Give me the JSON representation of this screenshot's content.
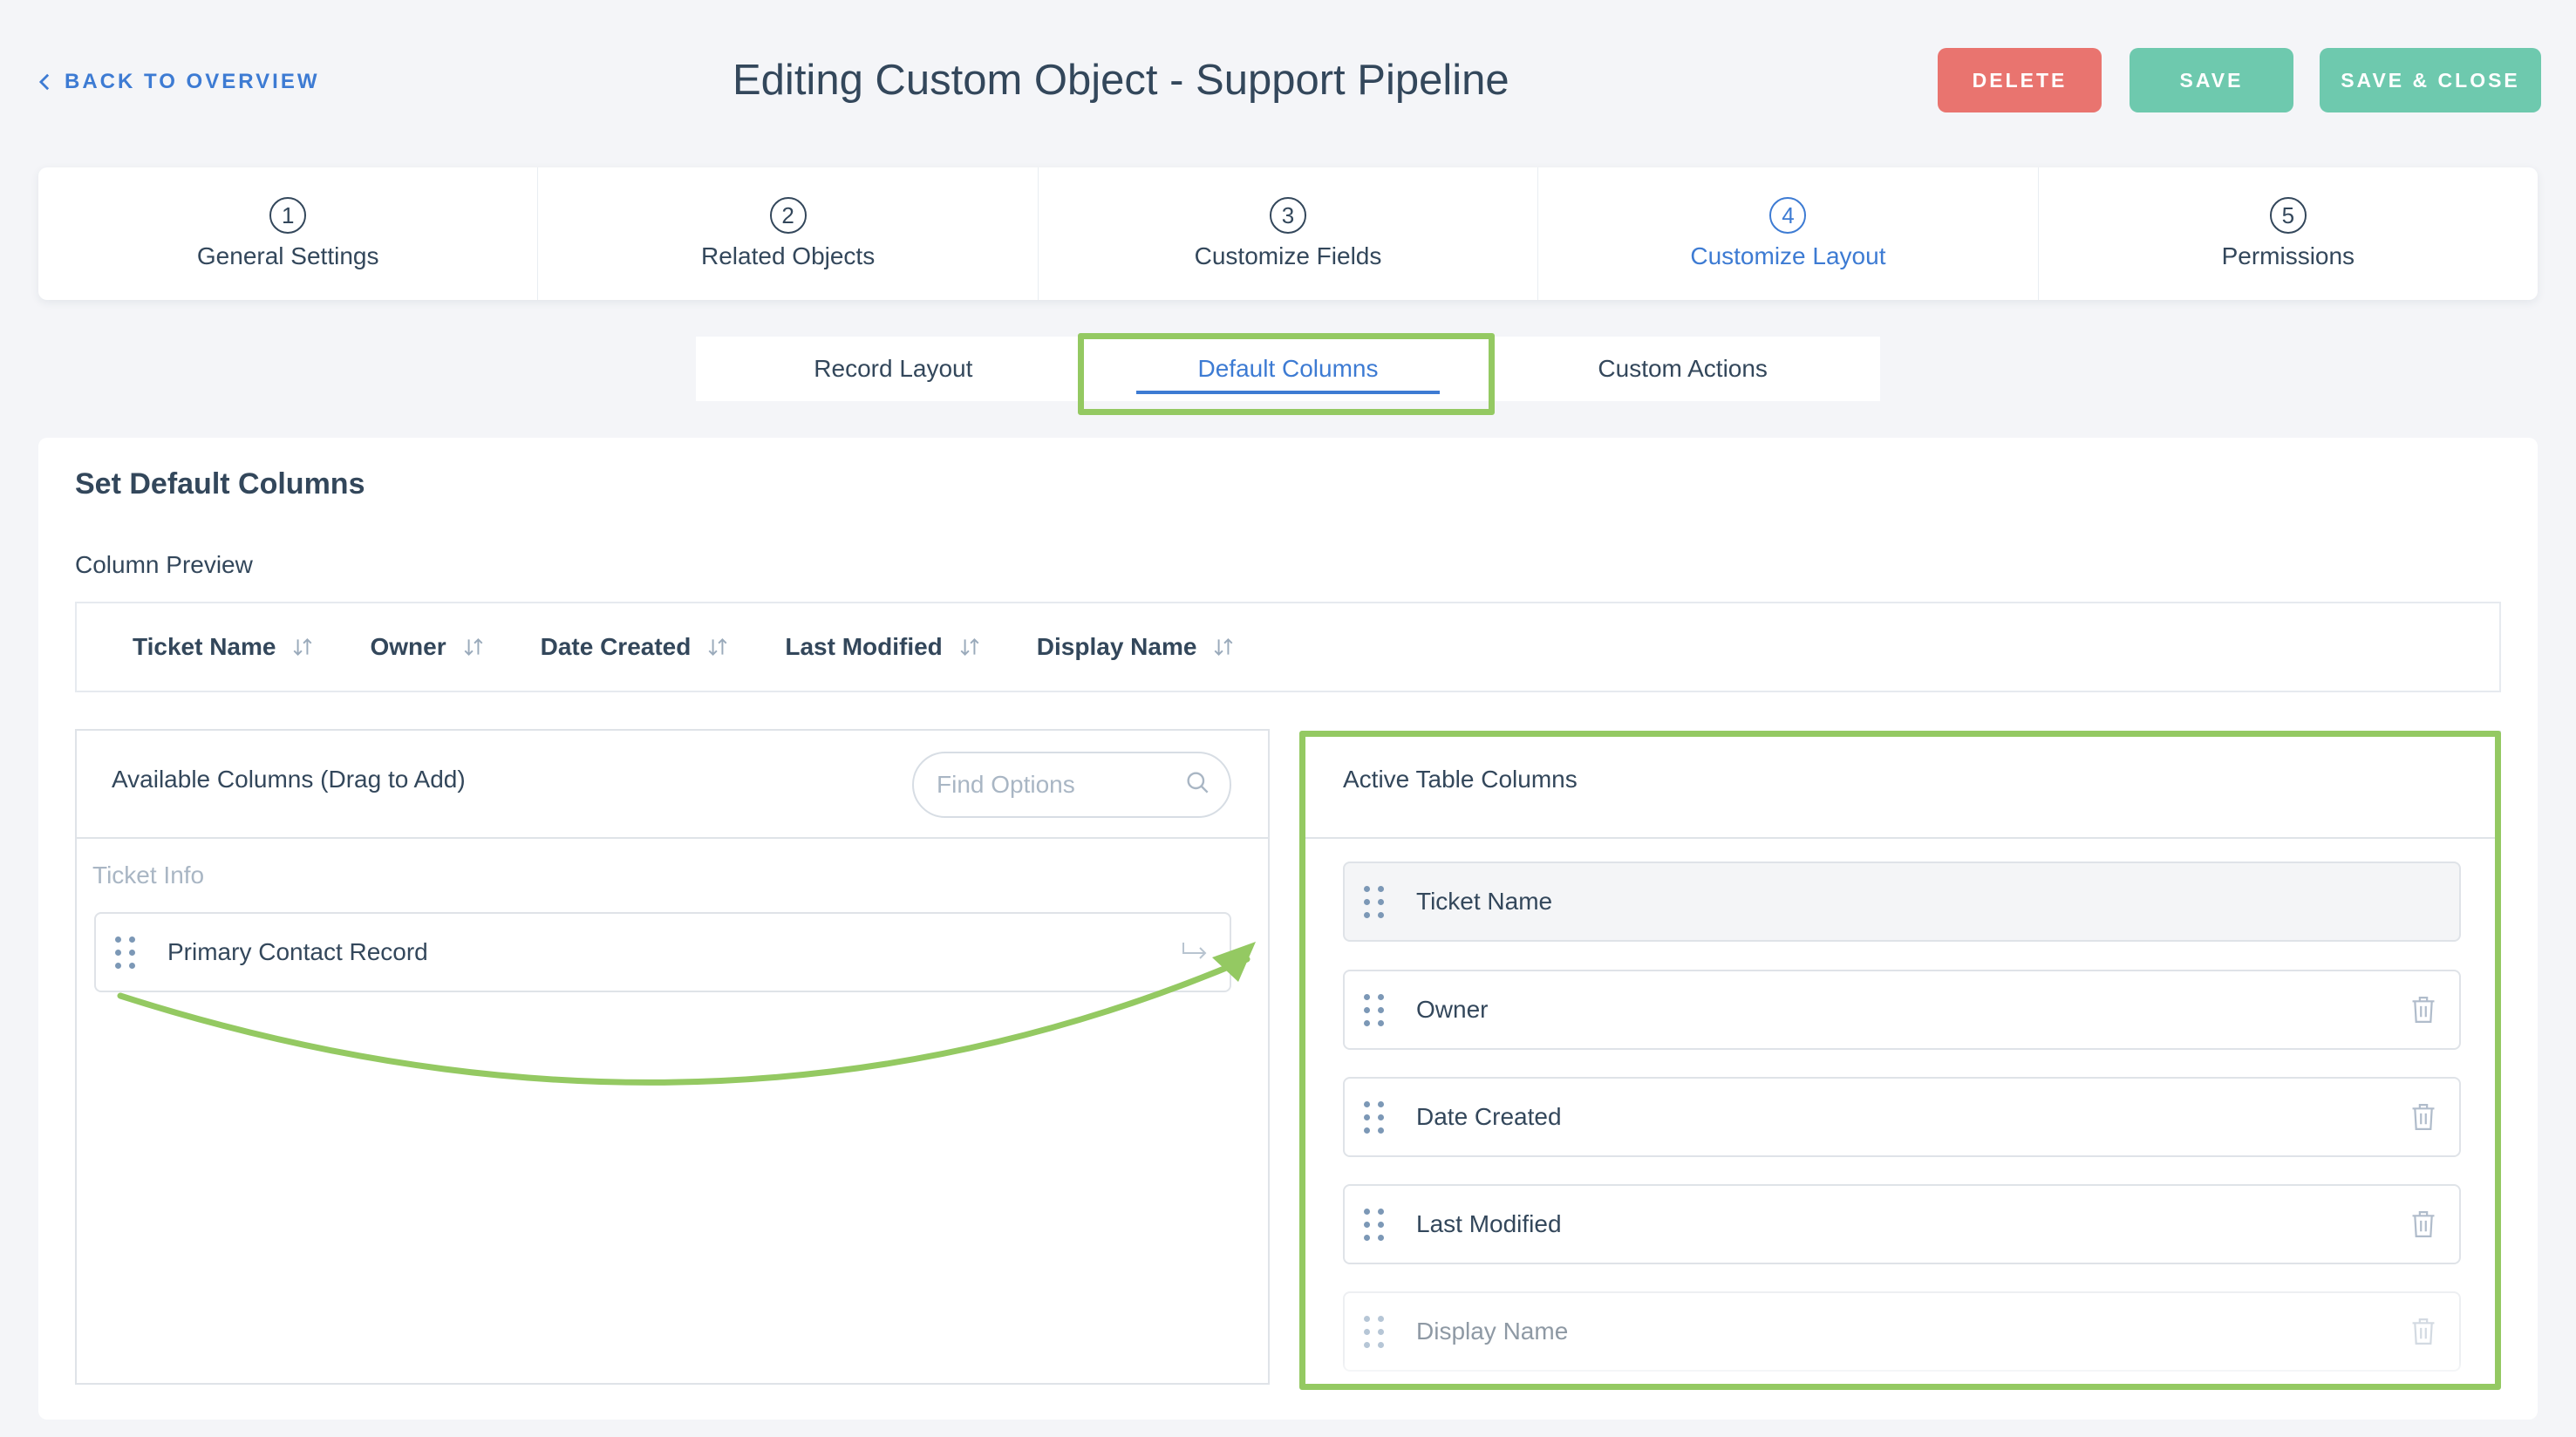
{
  "header": {
    "back_label": "BACK TO OVERVIEW",
    "title": "Editing Custom Object - Support Pipeline",
    "delete_label": "DELETE",
    "save_label": "SAVE",
    "save_close_label": "SAVE & CLOSE"
  },
  "steps": [
    {
      "num": "1",
      "label": "General Settings"
    },
    {
      "num": "2",
      "label": "Related Objects"
    },
    {
      "num": "3",
      "label": "Customize Fields"
    },
    {
      "num": "4",
      "label": "Customize Layout"
    },
    {
      "num": "5",
      "label": "Permissions"
    }
  ],
  "subtabs": [
    "Record Layout",
    "Default Columns",
    "Custom Actions"
  ],
  "main": {
    "title": "Set Default Columns",
    "preview_label": "Column Preview",
    "preview_columns": [
      "Ticket Name",
      "Owner",
      "Date Created",
      "Last Modified",
      "Display Name"
    ]
  },
  "available": {
    "title": "Available Columns (Drag to Add)",
    "search_placeholder": "Find Options",
    "group_label": "Ticket Info",
    "items": [
      "Primary Contact Record"
    ]
  },
  "active": {
    "title": "Active Table Columns",
    "items": [
      "Ticket Name",
      "Owner",
      "Date Created",
      "Last Modified",
      "Display Name"
    ]
  },
  "colors": {
    "accent_blue": "#3d7bd3",
    "delete_red": "#e9746f",
    "save_green": "#6ec9ae",
    "highlight_green": "#94c962",
    "text_dark": "#33475b"
  },
  "icons": {
    "back": "chevron-left-icon",
    "sort": "sort-icon",
    "search": "search-icon",
    "drag": "drag-handle-icon",
    "add": "add-arrow-icon",
    "delete": "trash-icon"
  }
}
